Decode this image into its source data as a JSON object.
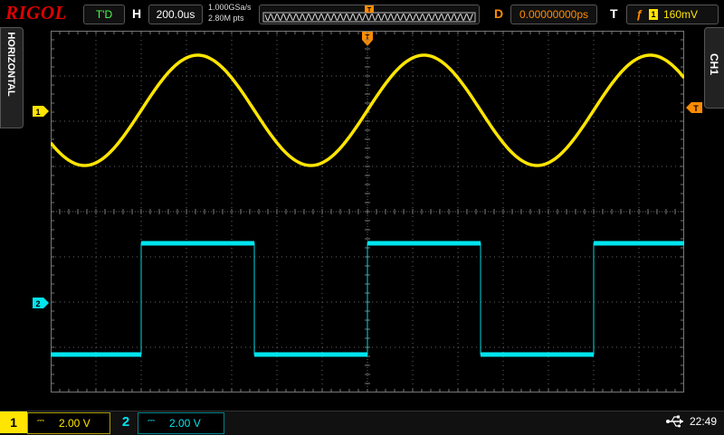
{
  "brand": "RIGOL",
  "top": {
    "run_status": "T'D",
    "horizontal_label": "H",
    "timebase": "200.0us",
    "sample_rate": "1.000GSa/s",
    "memory_depth": "2.80M pts",
    "delay_label": "D",
    "delay_value": "0.00000000ps",
    "trigger_label": "T",
    "trigger_source": "1",
    "trigger_level": "160mV"
  },
  "side": {
    "left_tab": "HORIZONTAL",
    "right_tab": "CH1"
  },
  "markers": {
    "ch1": "1",
    "ch2": "2",
    "trigger": "T"
  },
  "bottom": {
    "ch1_label": "1",
    "ch1_scale": "2.00 V",
    "ch2_label": "2",
    "ch2_scale": "2.00 V",
    "time": "22:49"
  },
  "colors": {
    "ch1": "#ffe500",
    "ch2": "#00e5ee",
    "trigger": "#ff8c00",
    "brand": "#e00000"
  },
  "icons": {
    "coupling": "dc-coupling-icon",
    "usb": "usb-icon"
  }
}
